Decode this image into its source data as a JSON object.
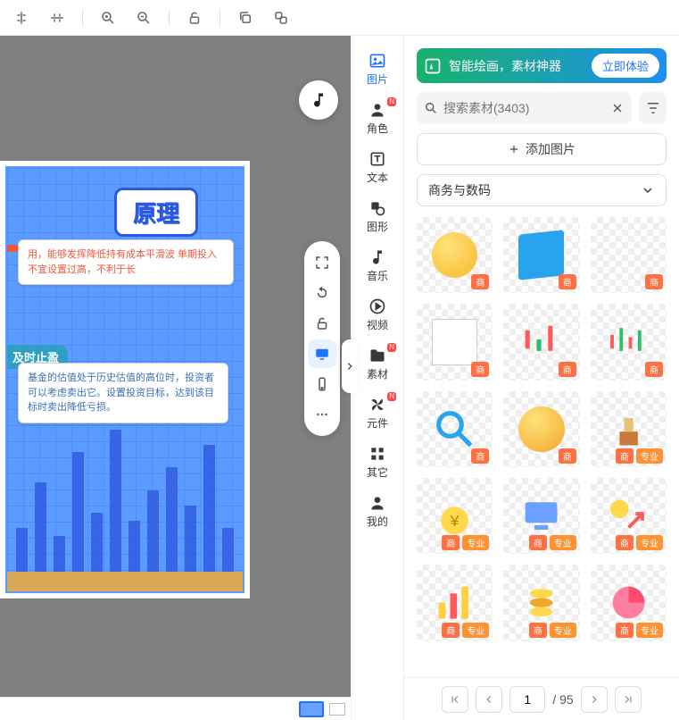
{
  "toolbar": {
    "items": [
      "align-v",
      "align-h",
      "zoom-in",
      "zoom-out",
      "unlock",
      "copy",
      "paste-behind"
    ]
  },
  "canvas": {
    "title": "原理",
    "section1_tag": " ",
    "section1_text": "用，能够发挥降低持有成本平滑波 单期投入不宜设置过高，不利于长",
    "section2_tag": "及时止盈",
    "section2_text": "基金的估值处于历史估值的高位时，投资者可以考虑卖出它。设置投资目标，达到该目标时卖出降低亏损。"
  },
  "rail": [
    {
      "key": "image",
      "label": "图片",
      "badge": false,
      "active": true
    },
    {
      "key": "role",
      "label": "角色",
      "badge": true,
      "active": false
    },
    {
      "key": "text",
      "label": "文本",
      "badge": false,
      "active": false
    },
    {
      "key": "shape",
      "label": "图形",
      "badge": false,
      "active": false
    },
    {
      "key": "music",
      "label": "音乐",
      "badge": false,
      "active": false
    },
    {
      "key": "video",
      "label": "视频",
      "badge": false,
      "active": false
    },
    {
      "key": "asset",
      "label": "素材",
      "badge": true,
      "active": false
    },
    {
      "key": "component",
      "label": "元件",
      "badge": true,
      "active": false
    },
    {
      "key": "other",
      "label": "其它",
      "badge": false,
      "active": false
    },
    {
      "key": "mine",
      "label": "我的",
      "badge": false,
      "active": false
    }
  ],
  "promo": {
    "text": "智能绘画，素材神器",
    "button": "立即体验"
  },
  "search": {
    "placeholder": "搜索素材(3403)"
  },
  "add_image": "添加图片",
  "category_select": "商务与数码",
  "asset_tags": {
    "biz": "商",
    "pro": "专业"
  },
  "pager": {
    "page": "1",
    "total": "/ 95"
  }
}
